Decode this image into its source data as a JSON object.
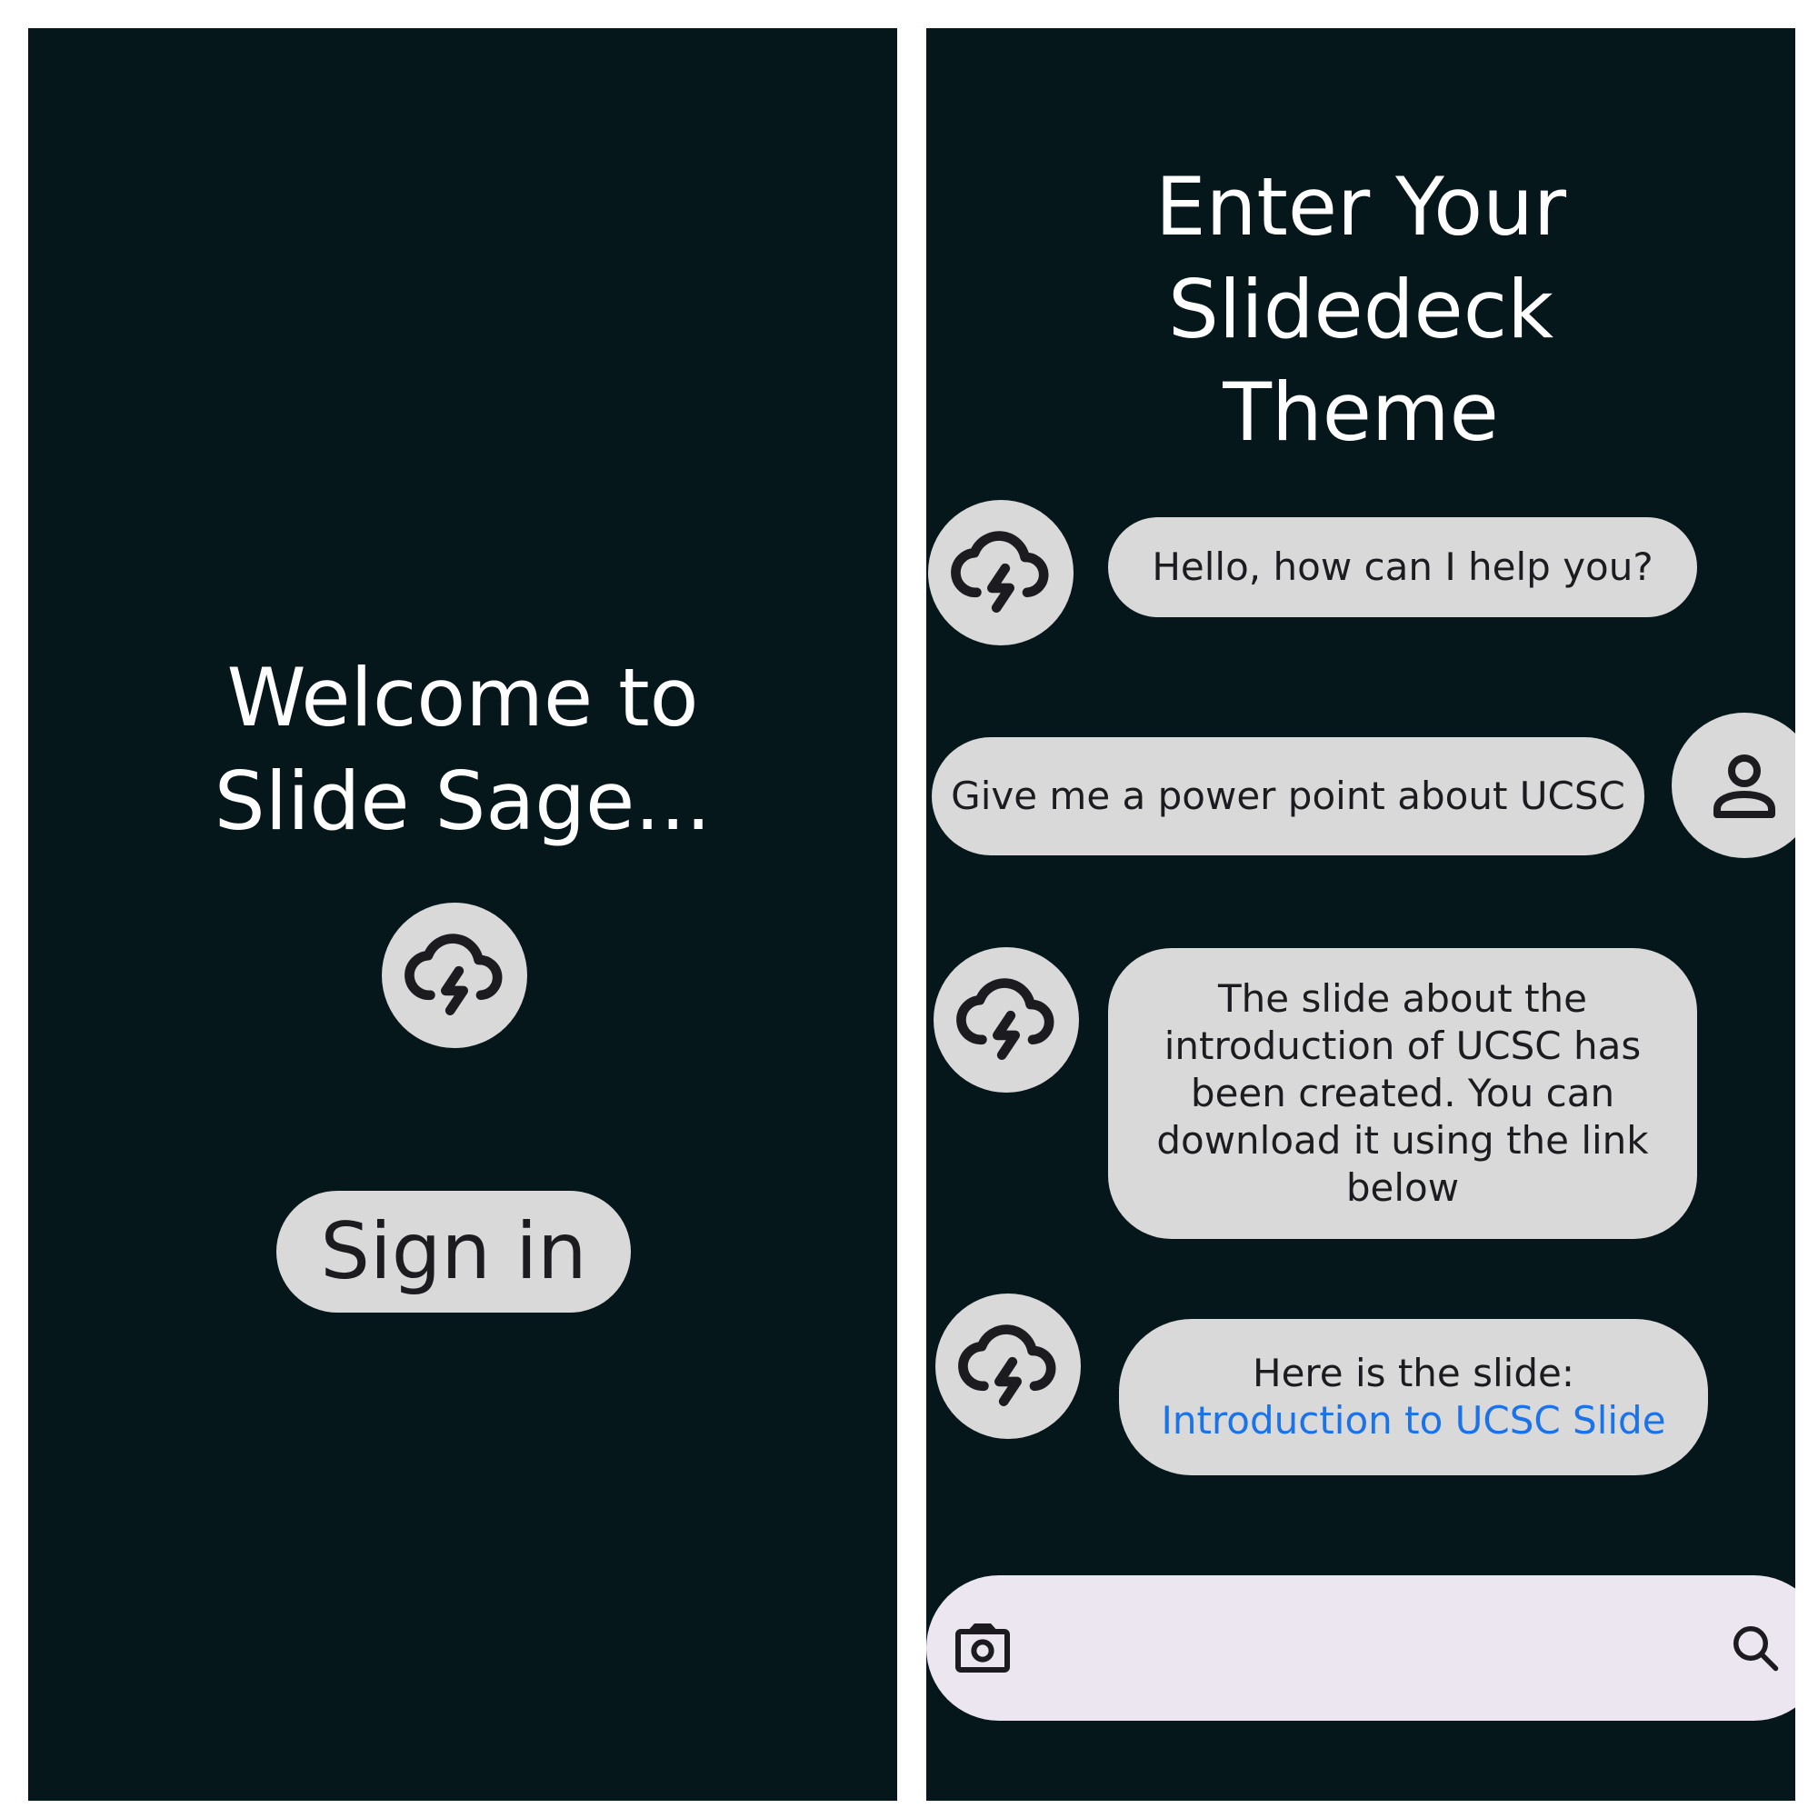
{
  "welcome_screen": {
    "title": "Welcome to\nSlide Sage...",
    "logo_icon": "cloud-lightning-icon",
    "sign_in_label": "Sign in"
  },
  "chat_screen": {
    "title": "Enter Your\nSlidedeck\nTheme",
    "messages": [
      {
        "sender": "bot",
        "icon": "cloud-lightning-icon",
        "text": "Hello, how can I help you?"
      },
      {
        "sender": "user",
        "icon": "person-icon",
        "text": "Give me a power point about UCSC"
      },
      {
        "sender": "bot",
        "icon": "cloud-lightning-icon",
        "text": "The slide about the introduction of UCSC has been created. You can download it using the link below"
      },
      {
        "sender": "bot",
        "icon": "cloud-lightning-icon",
        "text": "Here is the slide:",
        "link_text": "Introduction to UCSC Slide"
      }
    ],
    "search_bar": {
      "value": "",
      "leading_icon": "camera-icon",
      "trailing_icon": "search-icon"
    }
  },
  "colors": {
    "screen_background": "#05171a",
    "bubble_background": "#d9d9d9",
    "search_bar_background": "#ece6f0",
    "link": "#1a73e8",
    "title_text": "#ffffff"
  }
}
